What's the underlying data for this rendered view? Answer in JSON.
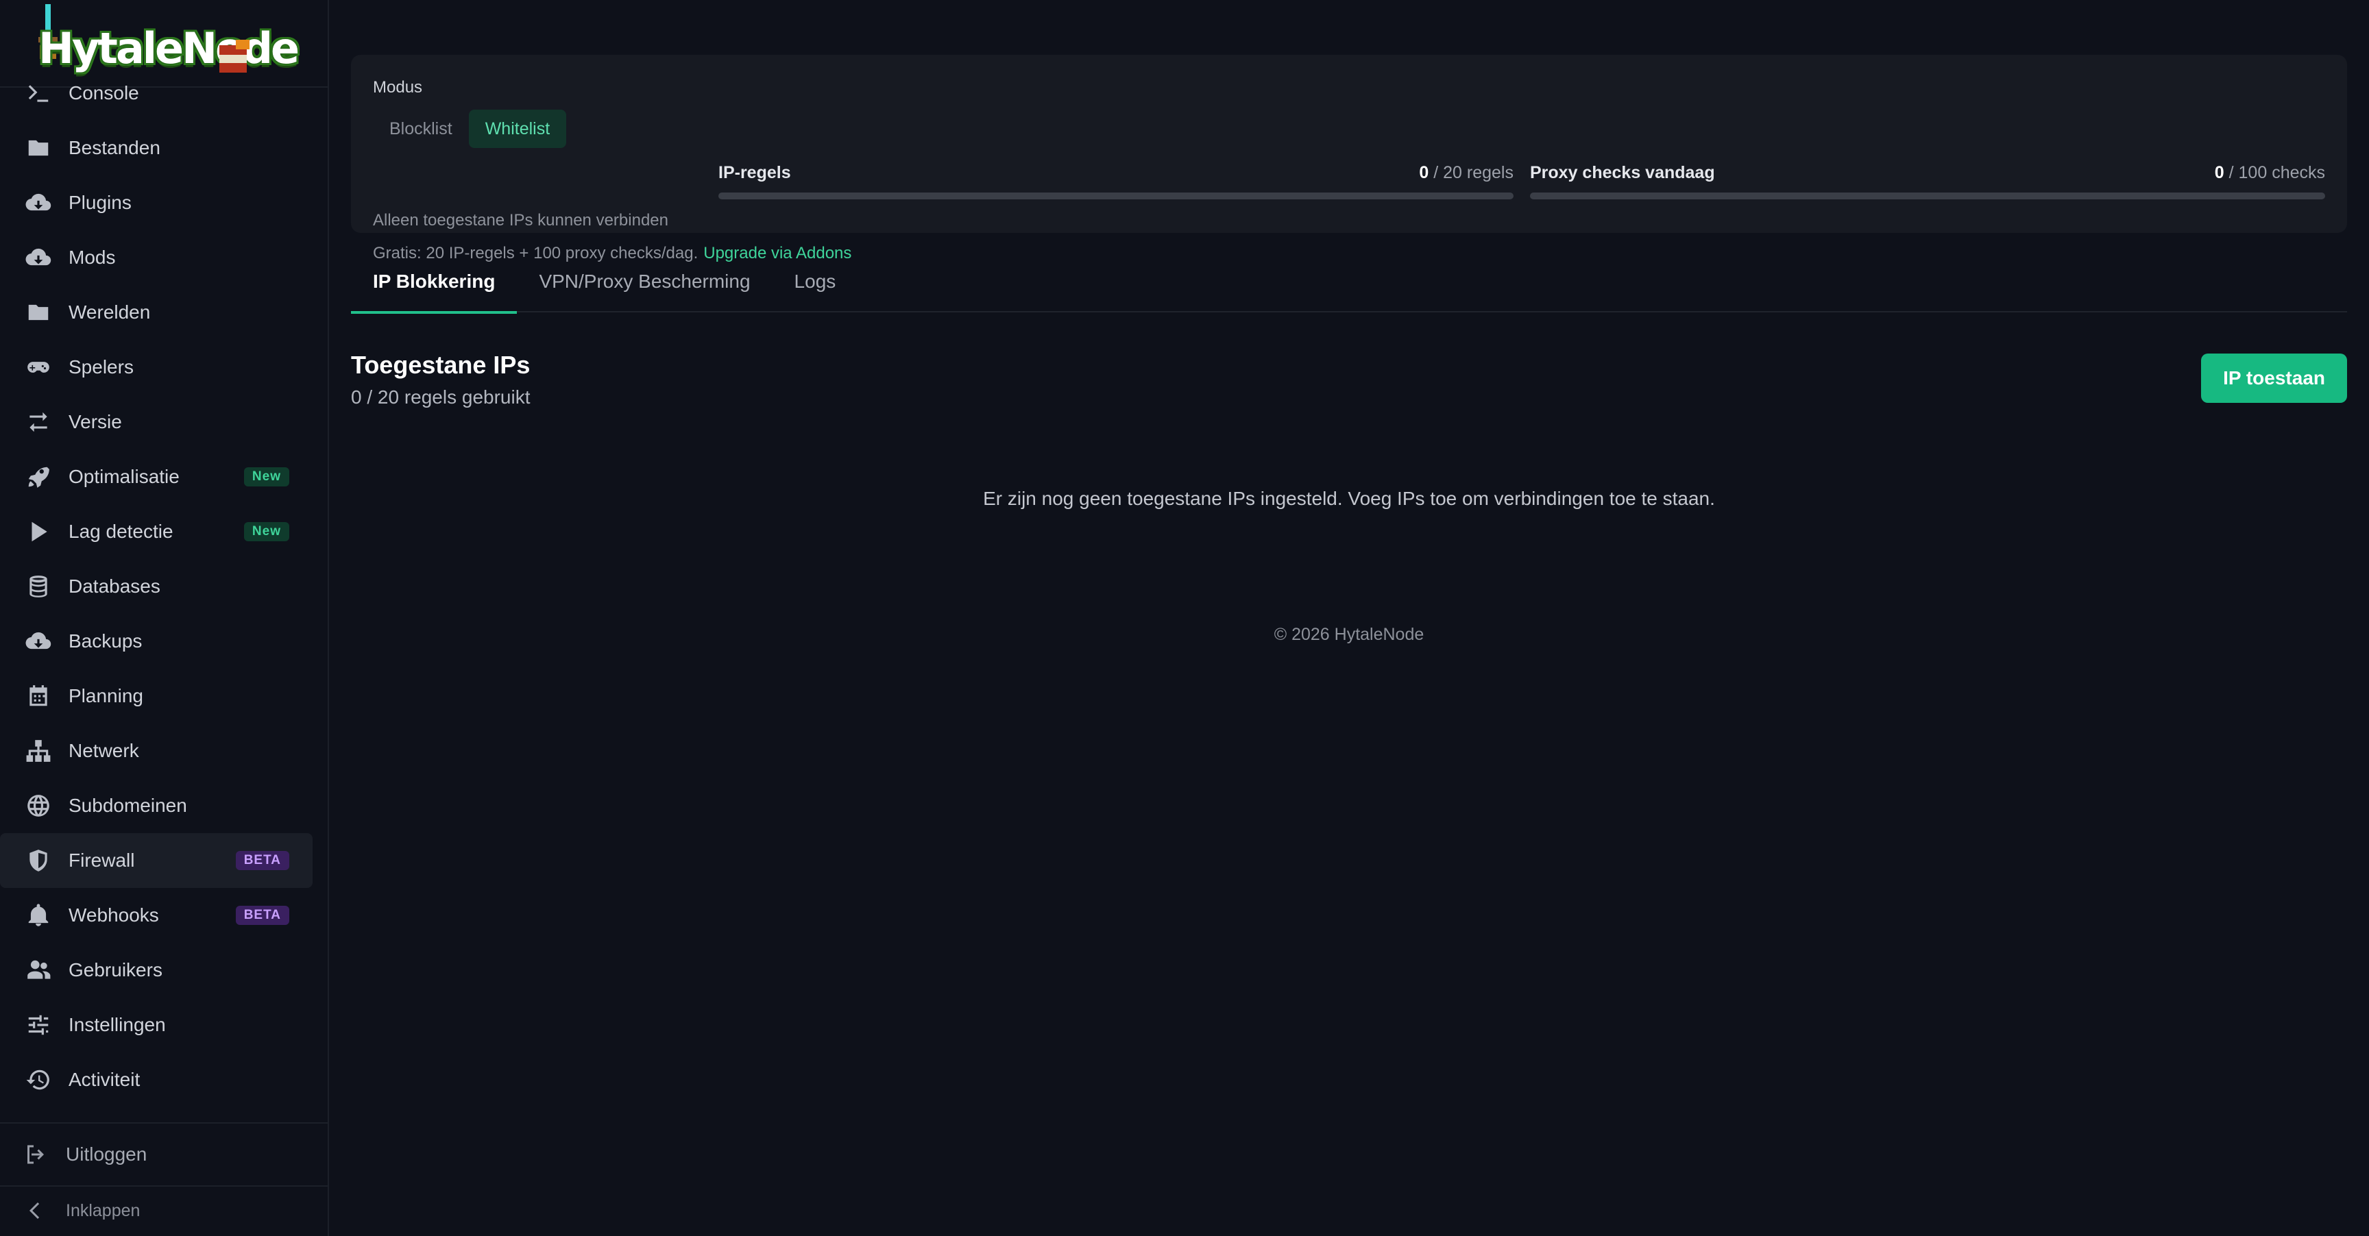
{
  "sidebar": {
    "logo_text": "HytaleNode",
    "items": [
      {
        "label": "Console",
        "icon": "terminal-icon"
      },
      {
        "label": "Bestanden",
        "icon": "folder-icon"
      },
      {
        "label": "Plugins",
        "icon": "cloud-download-icon"
      },
      {
        "label": "Mods",
        "icon": "cloud-download-icon"
      },
      {
        "label": "Werelden",
        "icon": "folder-icon"
      },
      {
        "label": "Spelers",
        "icon": "gamepad-icon"
      },
      {
        "label": "Versie",
        "icon": "swap-arrows-icon"
      },
      {
        "label": "Optimalisatie",
        "icon": "rocket-icon",
        "badge": "New"
      },
      {
        "label": "Lag detectie",
        "icon": "play-icon",
        "badge": "New"
      },
      {
        "label": "Databases",
        "icon": "database-icon"
      },
      {
        "label": "Backups",
        "icon": "cloud-download-icon"
      },
      {
        "label": "Planning",
        "icon": "calendar-icon"
      },
      {
        "label": "Netwerk",
        "icon": "network-icon"
      },
      {
        "label": "Subdomeinen",
        "icon": "globe-icon"
      },
      {
        "label": "Firewall",
        "icon": "shield-icon",
        "badge": "BETA",
        "active": true
      },
      {
        "label": "Webhooks",
        "icon": "bell-icon",
        "badge": "BETA"
      },
      {
        "label": "Gebruikers",
        "icon": "users-icon"
      },
      {
        "label": "Instellingen",
        "icon": "sliders-icon"
      },
      {
        "label": "Activiteit",
        "icon": "history-icon"
      }
    ],
    "logout_label": "Uitloggen",
    "collapse_label": "Inklappen"
  },
  "mode": {
    "title": "Modus",
    "options": [
      "Blocklist",
      "Whitelist"
    ],
    "selected": "Whitelist",
    "description": "Alleen toegestane IPs kunnen verbinden",
    "free_tier_text": "Gratis: 20 IP-regels + 100 proxy checks/dag.",
    "upgrade_link": "Upgrade via Addons"
  },
  "meters": {
    "ip_rules": {
      "label": "IP-regels",
      "used": "0",
      "limit_text": "/ 20 regels",
      "fraction": 0
    },
    "proxy_checks": {
      "label": "Proxy checks vandaag",
      "used": "0",
      "limit_text": "/ 100 checks",
      "fraction": 0
    }
  },
  "tabs": [
    "IP Blokkering",
    "VPN/Proxy Bescherming",
    "Logs"
  ],
  "active_tab": "IP Blokkering",
  "section": {
    "title": "Toegestane IPs",
    "subtitle": "0 / 20 regels gebruikt",
    "add_button": "IP toestaan",
    "empty_message": "Er zijn nog geen toegestane IPs ingesteld. Voeg IPs toe om verbindingen toe te staan."
  },
  "footer": {
    "copyright": "© 2026 HytaleNode"
  },
  "colors": {
    "accent": "#17b981",
    "background": "#0e111a",
    "card": "#171a22",
    "badge_new": "#3fd49a",
    "badge_beta": "#c9a0ff"
  }
}
